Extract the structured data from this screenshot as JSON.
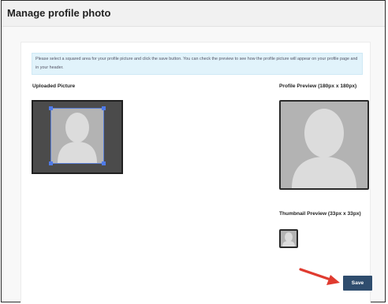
{
  "window": {
    "title": "Manage profile photo"
  },
  "info_message": "Please select a squared area for your profile picture and click the save button. You can check the preview to see how the profile picture will appear on your profile page and in your header.",
  "uploaded": {
    "label": "Uploaded Picture"
  },
  "preview": {
    "label": "Profile Preview (180px x 180px)"
  },
  "thumbnail": {
    "label": "Thumbnail Preview (33px x 33px)"
  },
  "actions": {
    "save_label": "Save"
  },
  "colors": {
    "accent": "#2f4d6e",
    "info_bg": "#e1f3fb",
    "crop_handle": "#4f7be8",
    "arrow": "#e03b30"
  },
  "icons": [
    "silhouette-placeholder",
    "arrow-pointer"
  ]
}
